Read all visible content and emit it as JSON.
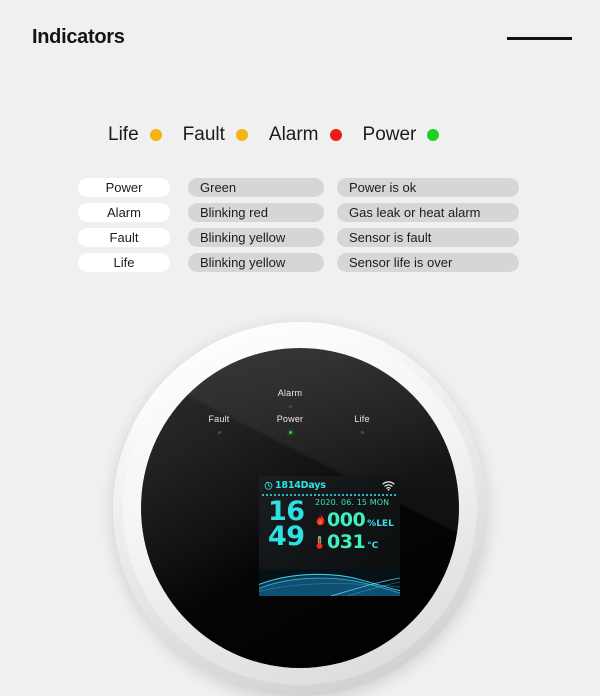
{
  "page": {
    "title": "Indicators",
    "background_color": "#f0f0f0",
    "rule_color": "#111111"
  },
  "legend": {
    "items": [
      {
        "label": "Life",
        "dot_color": "#f5b414",
        "dot_name": "life-indicator-dot"
      },
      {
        "label": "Fault",
        "dot_color": "#f5b414",
        "dot_name": "fault-indicator-dot"
      },
      {
        "label": "Alarm",
        "dot_color": "#ee1b19",
        "dot_name": "alarm-indicator-dot"
      },
      {
        "label": "Power",
        "dot_color": "#20cf22",
        "dot_name": "power-indicator-dot"
      }
    ]
  },
  "table": {
    "rows": [
      {
        "name": "Power",
        "color": "Green",
        "description": "Power is ok"
      },
      {
        "name": "Alarm",
        "color": "Blinking red",
        "description": "Gas leak or heat alarm"
      },
      {
        "name": "Fault",
        "color": "Blinking yellow",
        "description": "Sensor is fault"
      },
      {
        "name": "Life",
        "color": "Blinking yellow",
        "description": "Sensor life is over"
      }
    ]
  },
  "device": {
    "leds": [
      {
        "label": "Alarm",
        "state": "off"
      },
      {
        "label": "Fault",
        "state": "off"
      },
      {
        "label": "Power",
        "state": "on-green"
      },
      {
        "label": "Life",
        "state": "off"
      }
    ],
    "lcd": {
      "clock_icon": "clock-icon",
      "days": "1814Days",
      "wifi_icon": "wifi-icon",
      "time_hour": "16",
      "time_minute": "49",
      "date": "2020. 06. 15  MON",
      "gas": {
        "icon": "flame-icon",
        "value": "000",
        "unit": "%LEL"
      },
      "temperature": {
        "icon": "thermometer-icon",
        "value": "031",
        "unit": "°C"
      },
      "accent_cyan": "#2fe0e2",
      "accent_green": "#3ef0c0"
    }
  }
}
